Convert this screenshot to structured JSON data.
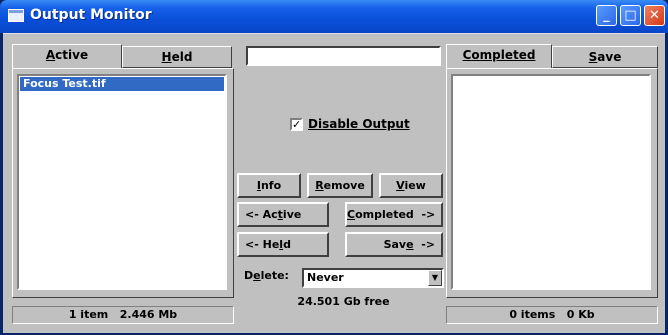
{
  "window": {
    "title": "Output Monitor"
  },
  "left_panel": {
    "tabs": [
      {
        "label_prefix": "",
        "accel": "A",
        "label_suffix": "ctive"
      },
      {
        "label_prefix": "",
        "accel": "H",
        "label_suffix": "eld"
      }
    ],
    "items": [
      "Focus Test.tif"
    ],
    "status": "1 item   2.446 Mb"
  },
  "right_panel": {
    "tabs": [
      {
        "label_prefix": "",
        "accel": "C",
        "label_suffix": "ompleted"
      },
      {
        "label_prefix": "",
        "accel": "S",
        "label_suffix": "ave"
      }
    ],
    "items": [],
    "status": "0 items   0 Kb"
  },
  "center": {
    "text_field_value": "",
    "disable_output": {
      "accel": "D",
      "rest": "isable Output",
      "checked": true,
      "mark": "✓"
    },
    "buttons": {
      "info": {
        "accel": "I",
        "rest": "nfo"
      },
      "remove": {
        "accel": "R",
        "rest": "emove"
      },
      "view": {
        "accel": "V",
        "rest": "iew"
      },
      "to_active": {
        "pre": "<- Ac",
        "accel": "t",
        "rest": "ive"
      },
      "to_completed": {
        "pre": "",
        "accel": "C",
        "rest": "ompleted  ->"
      },
      "to_held": {
        "pre": "<- He",
        "accel": "l",
        "rest": "d"
      },
      "to_save": {
        "pre": "Sav",
        "accel": "e",
        "rest": "  ->"
      }
    },
    "delete": {
      "label_pre": "D",
      "accel": "e",
      "label_rest": "lete:",
      "value": "Never",
      "arrow": "▼"
    },
    "free_space": "24.501 Gb free"
  },
  "title_buttons": {
    "minimize": "_",
    "maximize": "□",
    "close": "✕"
  }
}
